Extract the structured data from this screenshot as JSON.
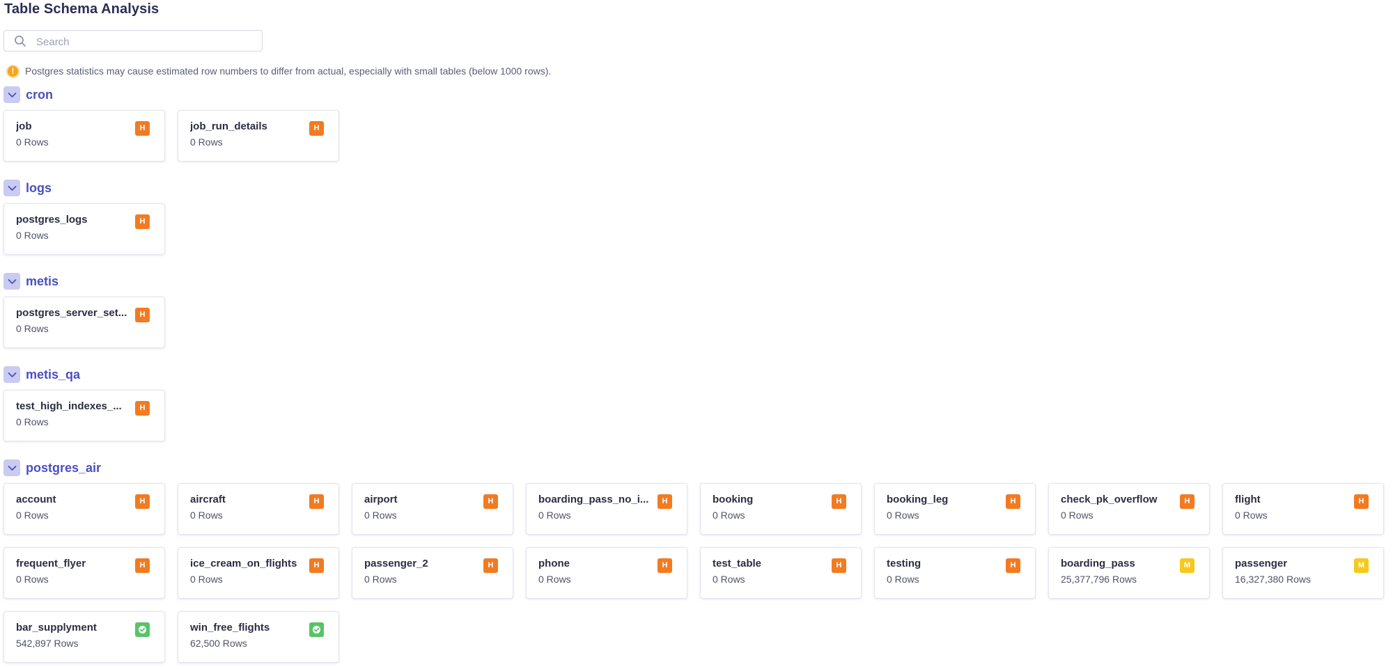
{
  "page": {
    "title": "Table Schema Analysis",
    "search_placeholder": "Search",
    "search_value": "",
    "notice": "Postgres statistics may cause estimated row numbers to differ from actual, especially with small tables (below 1000 rows)."
  },
  "colors": {
    "accent": "#4b4fbf",
    "badge_high": "#f27b22",
    "badge_medium": "#f7c81c",
    "badge_ok": "#55c566",
    "toggle_bg": "#c9cbf2",
    "warning": "#f6a31d"
  },
  "icons": {
    "search": "search-icon",
    "warning": "exclamation-circle-icon",
    "collapse": "chevron-down-icon",
    "ok": "check-icon"
  },
  "schemas": [
    {
      "name": "cron",
      "tables": [
        {
          "name": "job",
          "rows": "0 Rows",
          "badge": "H"
        },
        {
          "name": "job_run_details",
          "rows": "0 Rows",
          "badge": "H"
        }
      ]
    },
    {
      "name": "logs",
      "tables": [
        {
          "name": "postgres_logs",
          "rows": "0 Rows",
          "badge": "H"
        }
      ]
    },
    {
      "name": "metis",
      "tables": [
        {
          "name": "postgres_server_set...",
          "rows": "0 Rows",
          "badge": "H"
        }
      ]
    },
    {
      "name": "metis_qa",
      "tables": [
        {
          "name": "test_high_indexes_...",
          "rows": "0 Rows",
          "badge": "H"
        }
      ]
    },
    {
      "name": "postgres_air",
      "tables": [
        {
          "name": "account",
          "rows": "0 Rows",
          "badge": "H"
        },
        {
          "name": "aircraft",
          "rows": "0 Rows",
          "badge": "H"
        },
        {
          "name": "airport",
          "rows": "0 Rows",
          "badge": "H"
        },
        {
          "name": "boarding_pass_no_i...",
          "rows": "0 Rows",
          "badge": "H"
        },
        {
          "name": "booking",
          "rows": "0 Rows",
          "badge": "H"
        },
        {
          "name": "booking_leg",
          "rows": "0 Rows",
          "badge": "H"
        },
        {
          "name": "check_pk_overflow",
          "rows": "0 Rows",
          "badge": "H"
        },
        {
          "name": "flight",
          "rows": "0 Rows",
          "badge": "H"
        },
        {
          "name": "frequent_flyer",
          "rows": "0 Rows",
          "badge": "H"
        },
        {
          "name": "ice_cream_on_flights",
          "rows": "0 Rows",
          "badge": "H"
        },
        {
          "name": "passenger_2",
          "rows": "0 Rows",
          "badge": "H"
        },
        {
          "name": "phone",
          "rows": "0 Rows",
          "badge": "H"
        },
        {
          "name": "test_table",
          "rows": "0 Rows",
          "badge": "H"
        },
        {
          "name": "testing",
          "rows": "0 Rows",
          "badge": "H"
        },
        {
          "name": "boarding_pass",
          "rows": "25,377,796 Rows",
          "badge": "M"
        },
        {
          "name": "passenger",
          "rows": "16,327,380 Rows",
          "badge": "M"
        },
        {
          "name": "bar_supplyment",
          "rows": "542,897 Rows",
          "badge": "ok"
        },
        {
          "name": "win_free_flights",
          "rows": "62,500 Rows",
          "badge": "ok"
        }
      ]
    }
  ]
}
